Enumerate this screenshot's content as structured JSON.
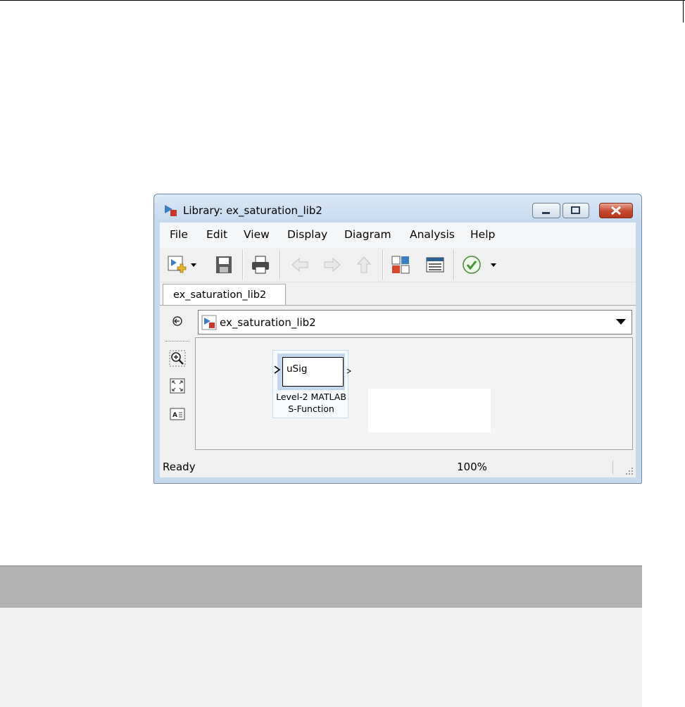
{
  "window": {
    "title": "Library: ex_saturation_lib2",
    "controls": {
      "minimize": "minimize",
      "maximize": "maximize",
      "close": "close"
    }
  },
  "menu": {
    "items": [
      "File",
      "Edit",
      "View",
      "Display",
      "Diagram",
      "Analysis",
      "Help"
    ]
  },
  "toolbar": {
    "icons": [
      "new-model-icon",
      "save-icon",
      "print-icon",
      "back-icon",
      "forward-icon",
      "up-icon",
      "library-browser-icon",
      "model-explorer-icon",
      "check-icon"
    ]
  },
  "tab": {
    "label": "ex_saturation_lib2"
  },
  "address": {
    "path": "ex_saturation_lib2"
  },
  "block": {
    "port_label": "uSig",
    "caption_line1": "Level-2 MATLAB",
    "caption_line2": "S-Function"
  },
  "status": {
    "text": "Ready",
    "zoom": "100%"
  },
  "colors": {
    "titlebar": "#c5d9ef",
    "close_button": "#c4452d",
    "block_highlight": "#c3d8ef",
    "table_header": "#b2b2b2"
  }
}
